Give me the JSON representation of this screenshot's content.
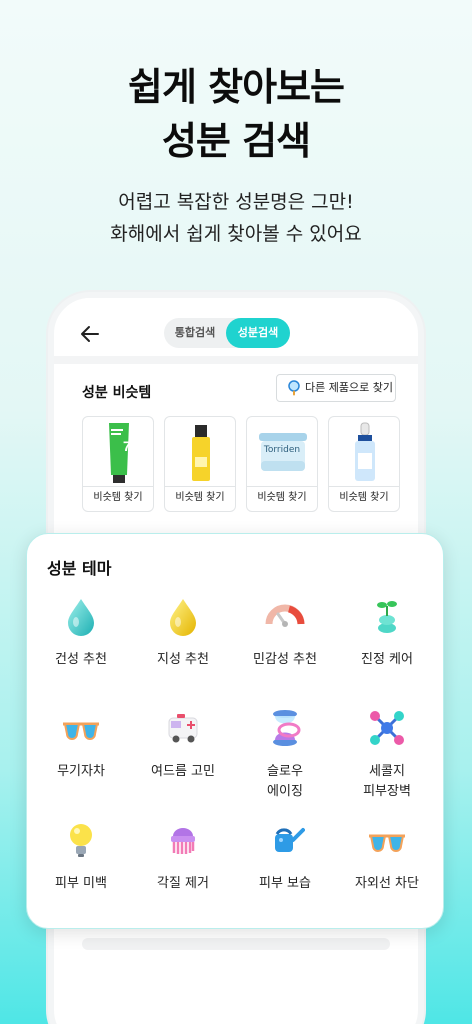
{
  "headline": {
    "line1": "쉽게 찾아보는",
    "line2": "성분 검색"
  },
  "subhead": {
    "line1": "어렵고 복잡한 성분명은 그만!",
    "line2": "화해에서 쉽게 찾아볼 수 있어요"
  },
  "app": {
    "tabs": [
      {
        "label": "통합검색",
        "active": false
      },
      {
        "label": "성분검색",
        "active": true
      }
    ],
    "best_section": {
      "title": "성분 비슷템",
      "find_button": "다른 제품으로 찾기",
      "products": [
        {
          "label": "비슷템 찾기",
          "icon": "green-tube-cream"
        },
        {
          "label": "비슷템 찾기",
          "icon": "yellow-serum-bottle"
        },
        {
          "label": "비슷템 찾기",
          "icon": "pad-jar",
          "brand": "Torriden"
        },
        {
          "label": "비슷템 찾기",
          "icon": "blue-dropper-bottle"
        }
      ]
    }
  },
  "theme": {
    "title": "성분 테마",
    "items": [
      {
        "label": "건성 추천",
        "icon": "water-drop-icon"
      },
      {
        "label": "지성 추천",
        "icon": "oil-drop-icon"
      },
      {
        "label": "민감성 추천",
        "icon": "gauge-icon"
      },
      {
        "label": "진정 케어",
        "icon": "sprout-icon"
      },
      {
        "label": "무기자차",
        "icon": "sunglasses-icon"
      },
      {
        "label": "여드름 고민",
        "icon": "ambulance-icon"
      },
      {
        "label": "슬로우\n에이징",
        "icon": "hourglass-icon"
      },
      {
        "label": "세콜지\n피부장벽",
        "icon": "molecule-icon"
      },
      {
        "label": "피부 미백",
        "icon": "lightbulb-icon"
      },
      {
        "label": "각질 제거",
        "icon": "brush-icon"
      },
      {
        "label": "피부 보습",
        "icon": "watering-can-icon"
      },
      {
        "label": "자외선 차단",
        "icon": "sunglasses-icon"
      }
    ]
  },
  "colors": {
    "accent": "#1fd3cf"
  }
}
